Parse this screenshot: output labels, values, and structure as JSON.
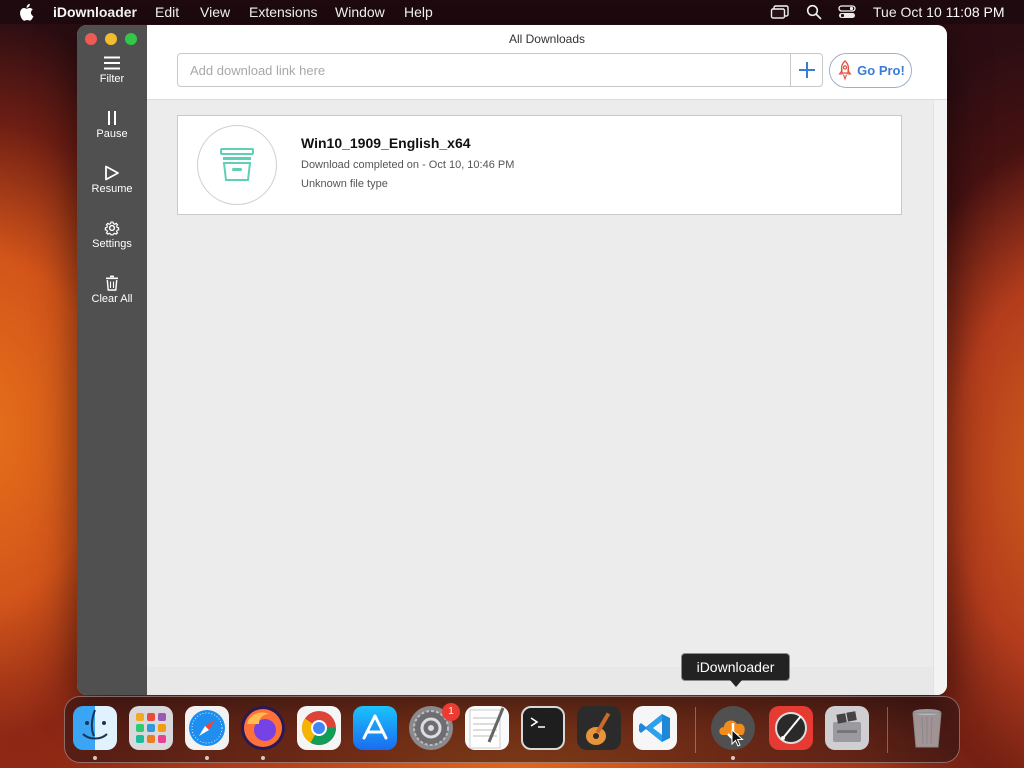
{
  "menubar": {
    "app_name": "iDownloader",
    "menus": [
      "Edit",
      "View",
      "Extensions",
      "Window",
      "Help"
    ],
    "clock": "Tue Oct 10  11:08 PM"
  },
  "window": {
    "title": "All Downloads",
    "url_placeholder": "Add download link here",
    "url_value": "",
    "gopro_label": "Go Pro!",
    "accent_color": "#3a7bd5"
  },
  "sidebar": {
    "items": [
      {
        "label": "Filter",
        "icon": "hamburger-icon"
      },
      {
        "label": "Pause",
        "icon": "pause-icon"
      },
      {
        "label": "Resume",
        "icon": "play-icon"
      },
      {
        "label": "Settings",
        "icon": "gear-icon"
      },
      {
        "label": "Clear All",
        "icon": "trash-icon"
      }
    ]
  },
  "downloads": [
    {
      "name": "Win10_1909_English_x64",
      "status": "Download completed on - Oct 10, 10:46 PM",
      "type": "Unknown file type",
      "icon": "archive-box-icon"
    }
  ],
  "dock": {
    "tooltip": "iDownloader",
    "apps": [
      {
        "name": "Finder",
        "icon": "finder-icon",
        "running": true
      },
      {
        "name": "Launchpad",
        "icon": "launchpad-icon",
        "running": false
      },
      {
        "name": "Safari",
        "icon": "safari-icon",
        "running": true
      },
      {
        "name": "Firefox",
        "icon": "firefox-icon",
        "running": true
      },
      {
        "name": "Chrome",
        "icon": "chrome-icon",
        "running": false
      },
      {
        "name": "App Store",
        "icon": "app-store-icon",
        "running": false
      },
      {
        "name": "System Preferences",
        "icon": "system-preferences-icon",
        "running": false,
        "badge": "1"
      },
      {
        "name": "TextEdit",
        "icon": "textedit-icon",
        "running": false
      },
      {
        "name": "Terminal",
        "icon": "terminal-icon",
        "running": false
      },
      {
        "name": "GarageBand",
        "icon": "garageband-icon",
        "running": false
      },
      {
        "name": "Visual Studio Code",
        "icon": "vscode-icon",
        "running": false
      },
      {
        "name": "iDownloader",
        "icon": "idownloader-icon",
        "running": true
      },
      {
        "name": "Digital Color Meter",
        "icon": "color-meter-icon",
        "running": false
      },
      {
        "name": "Boot Camp Assistant",
        "icon": "bootcamp-icon",
        "running": false
      },
      {
        "name": "Trash",
        "icon": "trash-dock-icon",
        "running": false
      }
    ]
  }
}
